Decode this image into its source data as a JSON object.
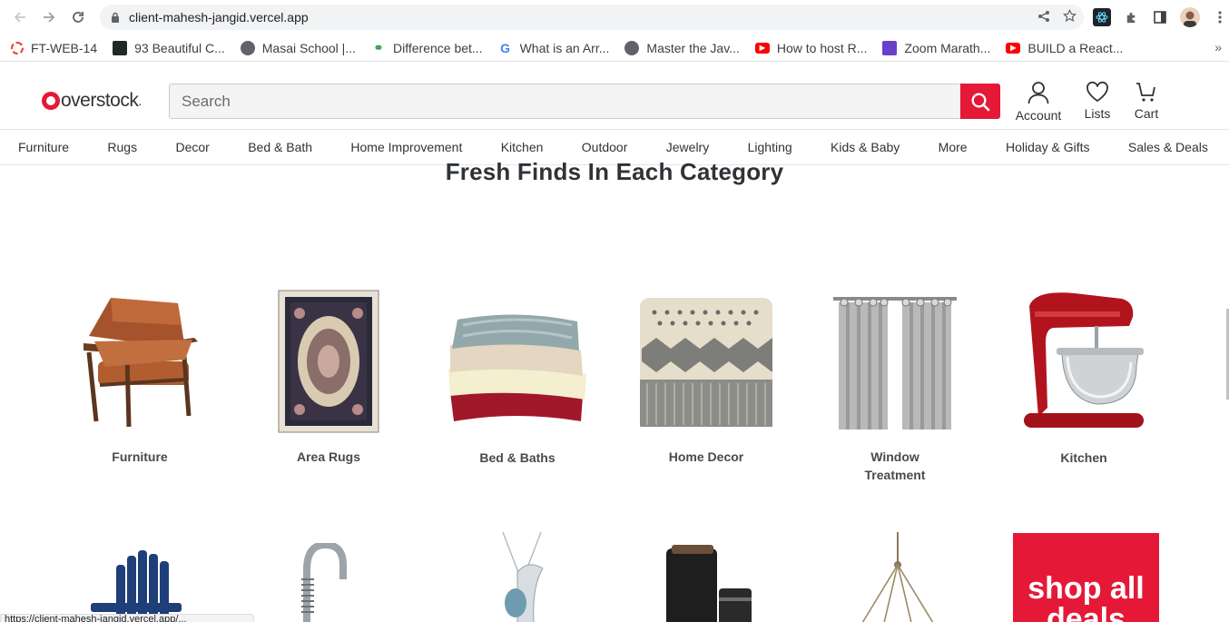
{
  "browser": {
    "url": "client-mahesh-jangid.vercel.app",
    "bookmarks": [
      {
        "label": "FT-WEB-14",
        "color": "#e94235"
      },
      {
        "label": "93 Beautiful C...",
        "color": "#1f2a24"
      },
      {
        "label": "Masai School |...",
        "color": "#5f6368"
      },
      {
        "label": "Difference bet...",
        "color": "#2e9e47"
      },
      {
        "label": "What is an Arr...",
        "color": "#4285f4"
      },
      {
        "label": "Master the Jav...",
        "color": "#5f6368"
      },
      {
        "label": "How to host R...",
        "color": "#ff0000"
      },
      {
        "label": "Zoom Marath...",
        "color": "#6a3fc9"
      },
      {
        "label": "BUILD a React...",
        "color": "#ff0000"
      }
    ],
    "more": "»",
    "status_url": "https://client-mahesh-jangid.vercel.app/..."
  },
  "header": {
    "logo": "overstock",
    "search_placeholder": "Search",
    "actions": [
      {
        "label": "Account",
        "icon": "user-icon"
      },
      {
        "label": "Lists",
        "icon": "heart-icon"
      },
      {
        "label": "Cart",
        "icon": "cart-icon"
      }
    ]
  },
  "nav": [
    "Furniture",
    "Rugs",
    "Decor",
    "Bed & Bath",
    "Home Improvement",
    "Kitchen",
    "Outdoor",
    "Jewelry",
    "Lighting",
    "Kids & Baby",
    "More",
    "Holiday & Gifts",
    "Sales & Deals"
  ],
  "main": {
    "title": "Fresh Finds In Each Category",
    "categories": [
      {
        "label": "Furniture"
      },
      {
        "label": "Area Rugs"
      },
      {
        "label": "Bed & Baths"
      },
      {
        "label": "Home Decor"
      },
      {
        "label": "Window\nTreatment"
      },
      {
        "label": "Kitchen"
      }
    ],
    "deals_tile": "shop all deals"
  },
  "colors": {
    "brand": "#e51937",
    "text": "#2f3337"
  }
}
